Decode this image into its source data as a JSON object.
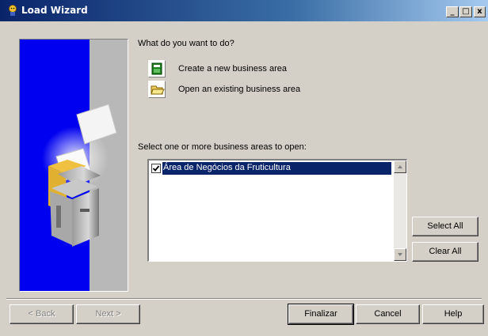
{
  "window": {
    "title": "Load Wizard",
    "controls": {
      "minimize": "_",
      "restore": "□",
      "close": "x"
    }
  },
  "prompt": "What do you want to do?",
  "options": [
    {
      "label": "Create a new business area",
      "icon": "new-business-area-icon"
    },
    {
      "label": "Open an existing business area",
      "icon": "open-business-area-icon"
    }
  ],
  "list": {
    "heading": "Select one or more business areas to open:",
    "items": [
      {
        "label": "Área de Negócios da Fruticultura",
        "checked": true,
        "selected": true
      }
    ]
  },
  "side_buttons": {
    "select_all": "Select All",
    "clear_all": "Clear All"
  },
  "footer": {
    "back": "< Back",
    "next": "Next >",
    "finish": "Finalizar",
    "cancel": "Cancel",
    "help": "Help"
  },
  "colors": {
    "titlebar_start": "#0a246a",
    "titlebar_end": "#a6caf0",
    "face": "#d4d0c8",
    "selection": "#0a246a",
    "banner_blue": "#0000f0"
  }
}
